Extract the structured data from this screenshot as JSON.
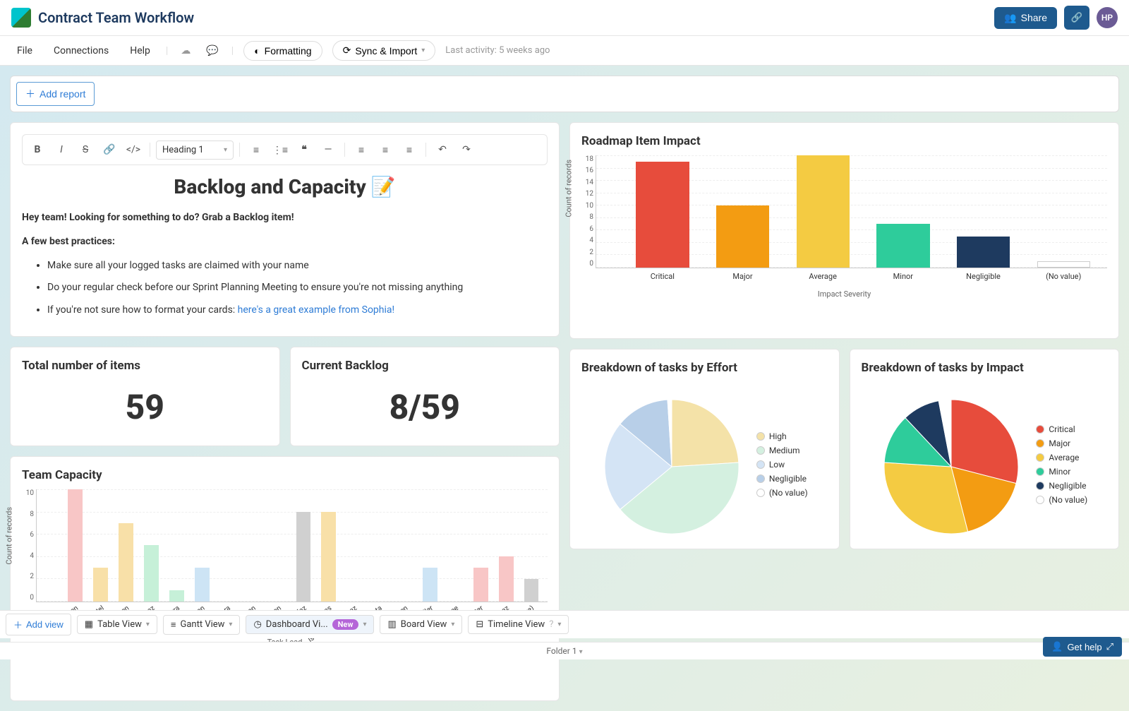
{
  "header": {
    "title": "Contract Team Workflow",
    "share_label": "Share",
    "avatar_initials": "HP"
  },
  "menubar": {
    "items": [
      "File",
      "Connections",
      "Help"
    ],
    "formatting_label": "Formatting",
    "sync_label": "Sync & Import",
    "activity_prefix": "Last activity:",
    "activity_value": "5 weeks ago"
  },
  "add_report_label": "Add report",
  "editor": {
    "heading_select": "Heading 1",
    "title": "Backlog and Capacity 📝",
    "intro": "Hey team! Looking for something to do? Grab a Backlog item!",
    "practices_heading": "A few best practices:",
    "bullets": [
      "Make sure all your logged tasks are claimed with your name",
      "Do your regular check before our Sprint Planning Meeting  to ensure you're not missing anything",
      "If you're not sure how to format your cards: "
    ],
    "link_text": "here's a great example from Sophia!"
  },
  "metrics": {
    "total_title": "Total number of items",
    "total_value": "59",
    "backlog_title": "Current Backlog",
    "backlog_value": "8/59"
  },
  "roadmap": {
    "title": "Roadmap Item Impact",
    "ylabel": "Count of records",
    "xlabel": "Impact Severity"
  },
  "capacity": {
    "title": "Team Capacity",
    "ylabel": "Count of records",
    "xlabel": "Task Lead"
  },
  "effort_pie": {
    "title": "Breakdown of tasks by Effort"
  },
  "impact_pie": {
    "title": "Breakdown of tasks by Impact"
  },
  "views": {
    "add_label": "Add view",
    "tabs": [
      "Table View",
      "Gantt View",
      "Dashboard Vi...",
      "Board View",
      "Timeline View"
    ],
    "new_badge": "New"
  },
  "folder_label": "Folder 1",
  "help_label": "Get help",
  "chart_data": [
    {
      "type": "bar",
      "title": "Roadmap Item Impact",
      "xlabel": "Impact Severity",
      "ylabel": "Count of records",
      "ylim": [
        0,
        18
      ],
      "categories": [
        "Critical",
        "Major",
        "Average",
        "Minor",
        "Negligible",
        "(No value)"
      ],
      "values": [
        17,
        10,
        18,
        7,
        5,
        1
      ],
      "colors": [
        "#e74c3c",
        "#f39c12",
        "#f4cb42",
        "#2ecc9b",
        "#1e3a5f",
        "#ffffff"
      ]
    },
    {
      "type": "bar",
      "title": "Team Capacity",
      "xlabel": "Task Lead",
      "ylabel": "Count of records",
      "ylim": [
        0,
        10
      ],
      "categories": [
        "Samantha Chen",
        "Jordan Patel",
        "Aisha Green",
        "Luis Martinez",
        "Emily Nakamura",
        "Grace Johnson",
        "Carlos Rivera",
        "Zara Thompson",
        "Maya Robinson",
        "Nina Hernandez",
        "Ethan Williams",
        "Isabella Rodriguez",
        "Rahul Gupta",
        "Sophia Nguyen",
        "Aiden Miller",
        "Jasmine Lee",
        "Dylan Carter",
        "Lena Perez",
        "(No value)"
      ],
      "values": [
        10,
        3,
        7,
        5,
        1,
        3,
        0,
        0,
        0,
        8,
        8,
        0,
        0,
        0,
        3,
        0,
        3,
        4,
        2
      ],
      "colors": [
        "#f8c6c6",
        "#f8e0a8",
        "#f8e0a8",
        "#c6f0d8",
        "#c6f0d8",
        "#cde4f5",
        "#cde4f5",
        "#cde4f5",
        "#d0d0d0",
        "#d0d0d0",
        "#f8e0a8",
        "#f8e0a8",
        "#f8e0a8",
        "#f8e0a8",
        "#cde4f5",
        "#cde4f5",
        "#f8c6c6",
        "#f8c6c6",
        "#d0d0d0"
      ]
    },
    {
      "type": "pie",
      "title": "Breakdown of tasks by Effort",
      "series": [
        {
          "name": "High",
          "value": 24,
          "color": "#f4e2a8"
        },
        {
          "name": "Medium",
          "value": 40,
          "color": "#d4f0e0"
        },
        {
          "name": "Low",
          "value": 22,
          "color": "#d4e4f5"
        },
        {
          "name": "Negligible",
          "value": 13,
          "color": "#b8cfe8"
        },
        {
          "name": "(No value)",
          "value": 1,
          "color": "#ffffff"
        }
      ]
    },
    {
      "type": "pie",
      "title": "Breakdown of tasks by Impact",
      "series": [
        {
          "name": "Critical",
          "value": 29,
          "color": "#e74c3c"
        },
        {
          "name": "Major",
          "value": 17,
          "color": "#f39c12"
        },
        {
          "name": "Average",
          "value": 30,
          "color": "#f4cb42"
        },
        {
          "name": "Minor",
          "value": 12,
          "color": "#2ecc9b"
        },
        {
          "name": "Negligible",
          "value": 9,
          "color": "#1e3a5f"
        },
        {
          "name": "(No value)",
          "value": 3,
          "color": "#ffffff"
        }
      ]
    }
  ]
}
